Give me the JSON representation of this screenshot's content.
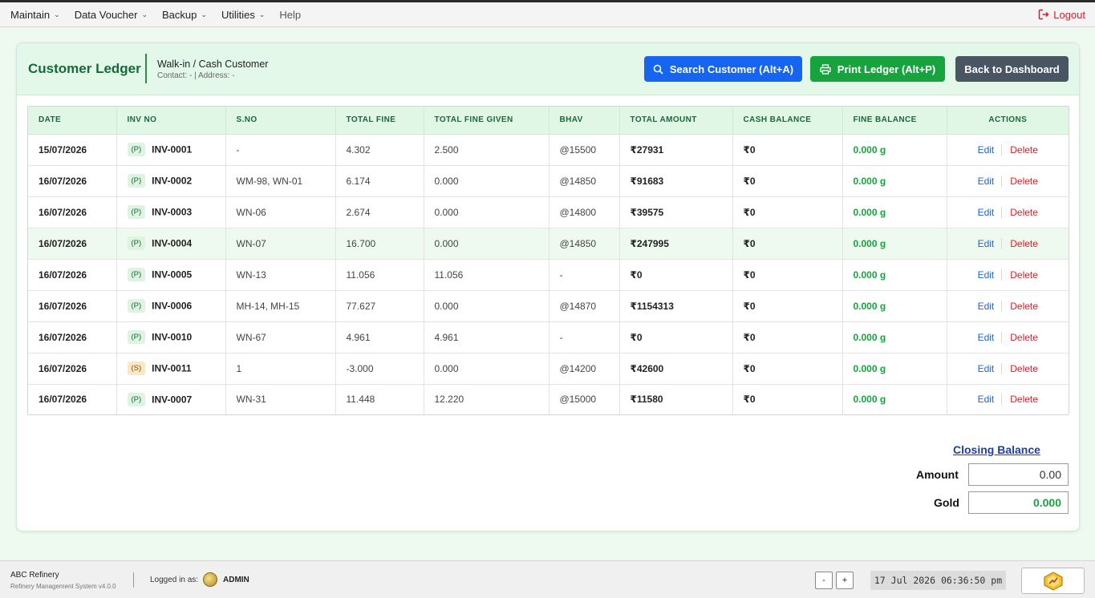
{
  "menu": {
    "items": [
      {
        "label": "Maintain",
        "has_dropdown": true
      },
      {
        "label": "Data Voucher",
        "has_dropdown": true
      },
      {
        "label": "Backup",
        "has_dropdown": true
      },
      {
        "label": "Utilities",
        "has_dropdown": true
      },
      {
        "label": "Help",
        "has_dropdown": false
      }
    ],
    "logout_label": "Logout"
  },
  "header": {
    "title": "Customer Ledger",
    "customer_name": "Walk-in / Cash Customer",
    "customer_meta": "Contact: - | Address: -",
    "search_button": "Search Customer (Alt+A)",
    "print_button": "Print Ledger (Alt+P)",
    "back_button": "Back to Dashboard"
  },
  "colors": {
    "accent_green": "#17a33e",
    "title_green": "#17693a",
    "search_blue": "#1565f0",
    "back_gray": "#4a5563",
    "delete_red": "#d0202a"
  },
  "table": {
    "columns": [
      "DATE",
      "INV NO",
      "S.NO",
      "TOTAL FINE",
      "TOTAL FINE GIVEN",
      "BHAV",
      "TOTAL AMOUNT",
      "CASH BALANCE",
      "FINE BALANCE",
      "ACTIONS"
    ],
    "edit_label": "Edit",
    "delete_label": "Delete",
    "rows": [
      {
        "date": "15/07/2026",
        "type": "(P)",
        "inv": "INV-0001",
        "sno": "-",
        "total_fine": "4.302",
        "fine_given": "2.500",
        "bhav": "@15500",
        "amount": "₹27931",
        "cash": "₹0",
        "fine_balance": "0.000 g"
      },
      {
        "date": "16/07/2026",
        "type": "(P)",
        "inv": "INV-0002",
        "sno": "WM-98, WN-01",
        "total_fine": "6.174",
        "fine_given": "0.000",
        "bhav": "@14850",
        "amount": "₹91683",
        "cash": "₹0",
        "fine_balance": "0.000 g"
      },
      {
        "date": "16/07/2026",
        "type": "(P)",
        "inv": "INV-0003",
        "sno": "WN-06",
        "total_fine": "2.674",
        "fine_given": "0.000",
        "bhav": "@14800",
        "amount": "₹39575",
        "cash": "₹0",
        "fine_balance": "0.000 g"
      },
      {
        "date": "16/07/2026",
        "type": "(P)",
        "inv": "INV-0004",
        "sno": "WN-07",
        "total_fine": "16.700",
        "fine_given": "0.000",
        "bhav": "@14850",
        "amount": "₹247995",
        "cash": "₹0",
        "fine_balance": "0.000 g",
        "highlight": true
      },
      {
        "date": "16/07/2026",
        "type": "(P)",
        "inv": "INV-0005",
        "sno": "WN-13",
        "total_fine": "11.056",
        "fine_given": "11.056",
        "bhav": "-",
        "amount": "₹0",
        "cash": "₹0",
        "fine_balance": "0.000 g"
      },
      {
        "date": "16/07/2026",
        "type": "(P)",
        "inv": "INV-0006",
        "sno": "MH-14, MH-15",
        "total_fine": "77.627",
        "fine_given": "0.000",
        "bhav": "@14870",
        "amount": "₹1154313",
        "cash": "₹0",
        "fine_balance": "0.000 g"
      },
      {
        "date": "16/07/2026",
        "type": "(P)",
        "inv": "INV-0010",
        "sno": "WN-67",
        "total_fine": "4.961",
        "fine_given": "4.961",
        "bhav": "-",
        "amount": "₹0",
        "cash": "₹0",
        "fine_balance": "0.000 g"
      },
      {
        "date": "16/07/2026",
        "type": "(S)",
        "inv": "INV-0011",
        "sno": "1",
        "total_fine": "-3.000",
        "fine_given": "0.000",
        "bhav": "@14200",
        "amount": "₹42600",
        "cash": "₹0",
        "fine_balance": "0.000 g"
      },
      {
        "date": "16/07/2026",
        "type": "(P)",
        "inv": "INV-0007",
        "sno": "WN-31",
        "total_fine": "11.448",
        "fine_given": "12.220",
        "bhav": "@15000",
        "amount": "₹11580",
        "cash": "₹0",
        "fine_balance": "0.000 g"
      }
    ]
  },
  "closing_balance": {
    "title": "Closing Balance",
    "amount_label": "Amount",
    "amount_value": "0.00",
    "gold_label": "Gold",
    "gold_value": "0.000"
  },
  "footer": {
    "company": "ABC Refinery",
    "version": "Refinery Management System v4.0.0",
    "logged_in_label": "Logged in as:",
    "user": "ADMIN",
    "zoom_out": "-",
    "zoom_in": "+",
    "clock": "17 Jul 2026 06:36:50 pm"
  }
}
